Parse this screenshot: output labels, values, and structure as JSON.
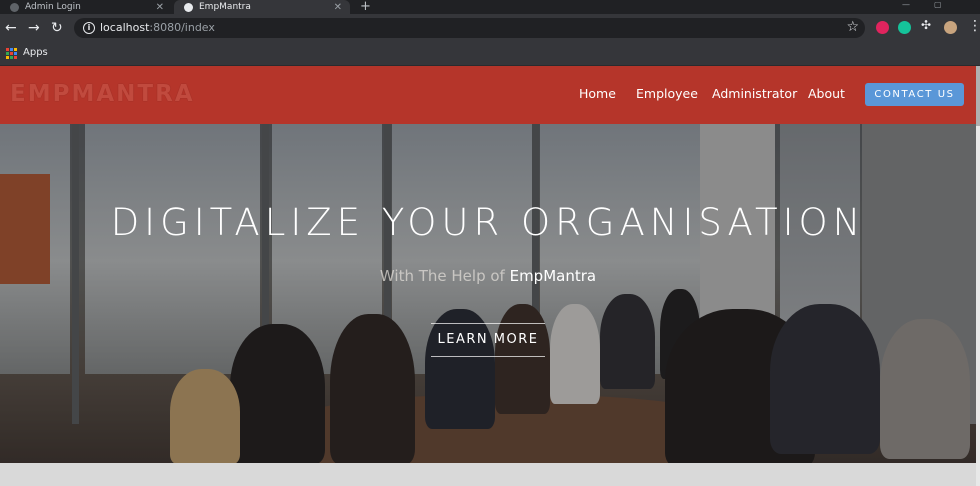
{
  "browser": {
    "tabs": [
      {
        "title": "Admin Login",
        "active": false
      },
      {
        "title": "EmpMantra",
        "active": true
      }
    ],
    "new_tab_icon": "plus-icon",
    "address": {
      "host": "localhost",
      "rest": ":8080/index"
    },
    "bookmarks": {
      "apps_label": "Apps"
    },
    "icons": {
      "back": "arrow-left-icon",
      "forward": "arrow-right-icon",
      "reload": "reload-icon",
      "site_info": "info-icon",
      "bookmark": "star-icon",
      "menu": "kebab-menu-icon"
    },
    "extension_colors": [
      "#e0245e",
      "#15c39a",
      "#bdc1c6",
      "#c8a47e"
    ]
  },
  "site": {
    "logo": "EMPMANTRA",
    "nav": [
      "Home",
      "Employee",
      "Administrator",
      "About"
    ],
    "contact_label": "CONTACT US",
    "colors": {
      "navbar": "#b5352a",
      "contact_button": "#5a97d8"
    }
  },
  "hero": {
    "headline": "DIGITALIZE YOUR ORGANISATION",
    "subline_prefix": "With The Help of ",
    "subline_brand": "EmpMantra",
    "cta_label": "LEARN MORE"
  }
}
